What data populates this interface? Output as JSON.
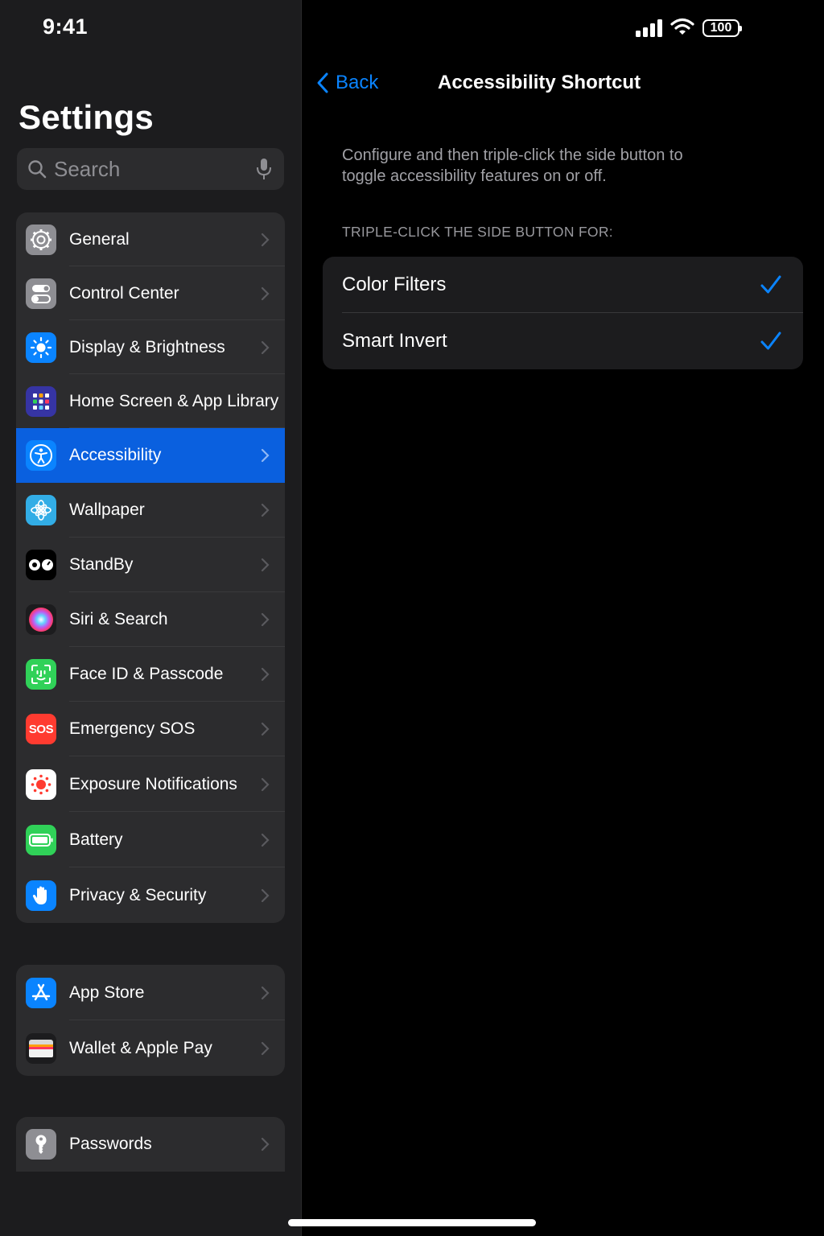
{
  "status_bar": {
    "time": "9:41",
    "battery": "100"
  },
  "sidebar": {
    "title": "Settings",
    "search": {
      "placeholder": "Search"
    },
    "group1": [
      {
        "label": "General",
        "icon": "gear-icon",
        "color": "#8e8e93"
      },
      {
        "label": "Control Center",
        "icon": "toggles-icon",
        "color": "#8e8e93"
      },
      {
        "label": "Display & Brightness",
        "icon": "sun-icon",
        "color": "#0a84ff"
      },
      {
        "label": "Home Screen & App Library",
        "icon": "app-grid-icon",
        "color": "#3634a3"
      },
      {
        "label": "Accessibility",
        "icon": "accessibility-icon",
        "color": "#0a84ff",
        "selected": true
      },
      {
        "label": "Wallpaper",
        "icon": "flower-icon",
        "color": "#32ade6"
      },
      {
        "label": "StandBy",
        "icon": "standby-icon",
        "color": "#000000"
      },
      {
        "label": "Siri & Search",
        "icon": "siri-icon",
        "color": "#1c1c1e"
      },
      {
        "label": "Face ID & Passcode",
        "icon": "face-id-icon",
        "color": "#30d158"
      },
      {
        "label": "Emergency SOS",
        "icon": "sos-icon",
        "color": "#ff3b30",
        "icon_text": "SOS"
      },
      {
        "label": "Exposure Notifications",
        "icon": "exposure-icon",
        "color": "#ffffff"
      },
      {
        "label": "Battery",
        "icon": "battery-icon",
        "color": "#30d158"
      },
      {
        "label": "Privacy & Security",
        "icon": "hand-icon",
        "color": "#0a84ff"
      }
    ],
    "group2": [
      {
        "label": "App Store",
        "icon": "app-store-icon",
        "color": "#0a84ff"
      },
      {
        "label": "Wallet & Apple Pay",
        "icon": "wallet-icon",
        "color": "#1c1c1e"
      }
    ],
    "group3": [
      {
        "label": "Passwords",
        "icon": "key-icon",
        "color": "#8e8e93"
      }
    ]
  },
  "detail": {
    "back_label": "Back",
    "title": "Accessibility Shortcut",
    "description": "Configure and then triple-click the side button to toggle accessibility features on or off.",
    "section_header": "TRIPLE-CLICK THE SIDE BUTTON FOR:",
    "options": [
      {
        "label": "Color Filters",
        "checked": true
      },
      {
        "label": "Smart Invert",
        "checked": true
      }
    ]
  },
  "colors": {
    "accent": "#0a84ff",
    "selected_row": "#0a60df"
  }
}
